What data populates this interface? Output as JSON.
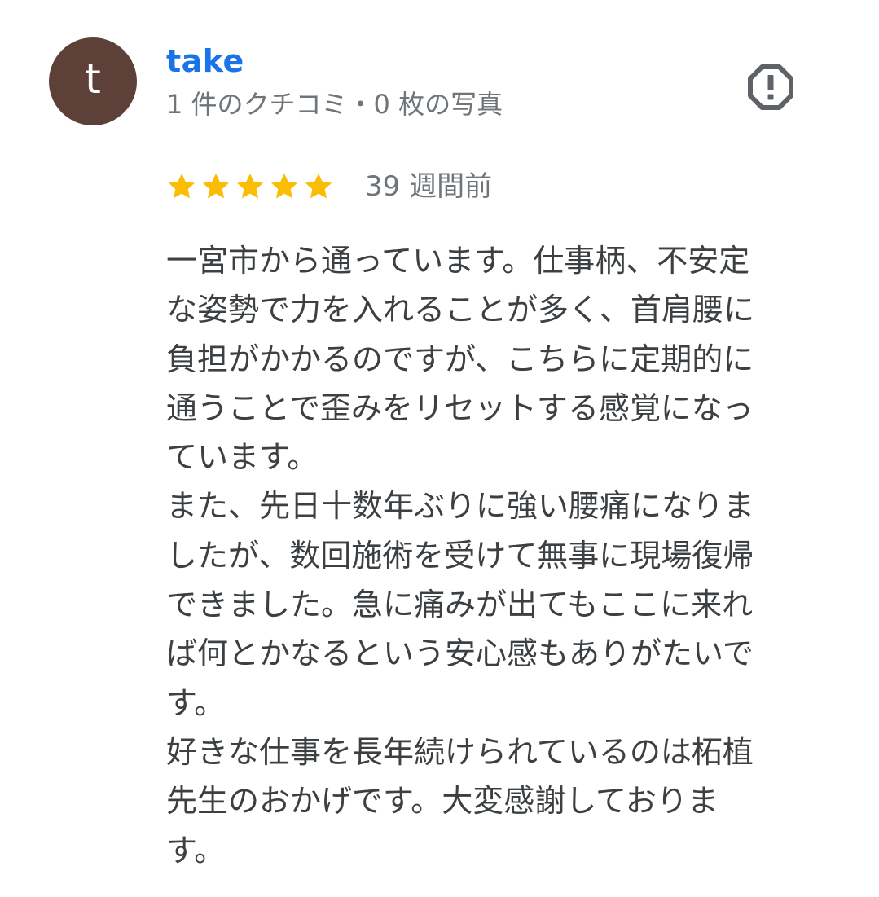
{
  "author": {
    "initial": "t",
    "name": "take",
    "meta": "1 件のクチコミ・0 枚の写真",
    "avatar_color": "#5d4037",
    "name_color": "#1a73e8"
  },
  "report_icon": "report-flag-octagon-exclamation",
  "rating": {
    "value": 5,
    "max": 5,
    "star_color": "#fbbc04",
    "date": "39 週間前"
  },
  "review": {
    "lines": [
      "一宮市から通っています。仕事柄、不安定",
      "な姿勢で力を入れることが多く、首肩腰に",
      "負担がかかるのですが、こちらに定期的に",
      "通うことで歪みをリセットする感覚になっ",
      "ています。",
      "また、先日十数年ぶりに強い腰痛になりま",
      "したが、数回施術を受けて無事に現場復帰",
      "できました。急に痛みが出てもここに来れ",
      "ば何とかなるという安心感もありがたいで",
      "す。",
      "好きな仕事を長年続けられているのは柘植",
      "先生のおかげです。大変感謝しておりま",
      "す。"
    ]
  }
}
